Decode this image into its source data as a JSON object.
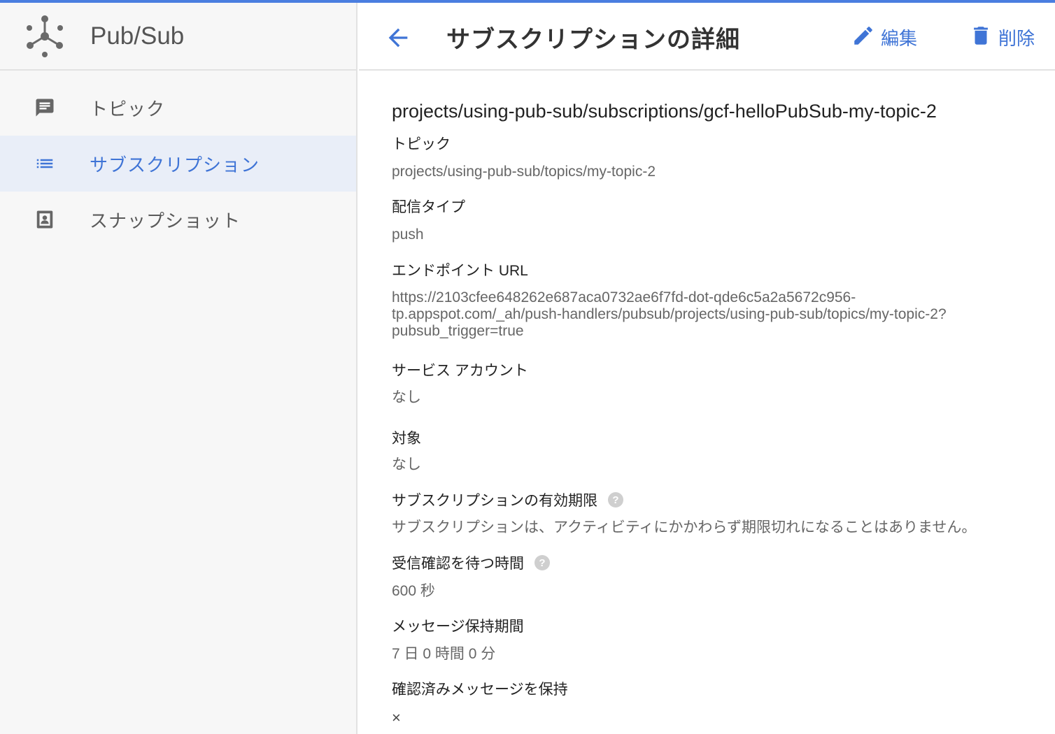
{
  "app": {
    "title": "Pub/Sub",
    "accent_color": "#4a7ee0",
    "logo_icon": "pubsub-logo-icon"
  },
  "sidebar": {
    "items": [
      {
        "label": "トピック",
        "icon": "message-icon",
        "active": false
      },
      {
        "label": "サブスクリプション",
        "icon": "list-icon",
        "active": true
      },
      {
        "label": "スナップショット",
        "icon": "snapshot-icon",
        "active": false
      }
    ]
  },
  "header": {
    "back_icon": "arrow-back-icon",
    "title": "サブスクリプションの詳細",
    "edit_label": "編集",
    "edit_icon": "pencil-icon",
    "delete_label": "削除",
    "delete_icon": "trash-icon"
  },
  "detail": {
    "subscription_name": "projects/using-pub-sub/subscriptions/gcf-helloPubSub-my-topic-2",
    "topic_label": "トピック",
    "topic_value": "projects/using-pub-sub/topics/my-topic-2",
    "delivery_type_label": "配信タイプ",
    "delivery_type_value": "push",
    "endpoint_label": "エンドポイント URL",
    "endpoint_line1": "https://2103cfee648262e687aca0732ae6f7fd-dot-qde6c5a2a5672c956-",
    "endpoint_line2": "tp.appspot.com/_ah/push-handlers/pubsub/projects/using-pub-sub/topics/my-topic-2?",
    "endpoint_line3": "pubsub_trigger=true",
    "service_account_label": "サービス アカウント",
    "service_account_value": "なし",
    "audience_label": "対象",
    "audience_value": "なし",
    "expiration_label": "サブスクリプションの有効期限",
    "expiration_value": "サブスクリプションは、アクティビティにかかわらず期限切れになることはありません。",
    "ack_deadline_label": "受信確認を待つ時間",
    "ack_deadline_value": "600 秒",
    "retention_label": "メッセージ保持期間",
    "retention_value": "7 日 0 時間 0 分",
    "retain_acked_label": "確認済みメッセージを保持",
    "retain_acked_value": "×",
    "help_icon": "help-circle-icon"
  }
}
